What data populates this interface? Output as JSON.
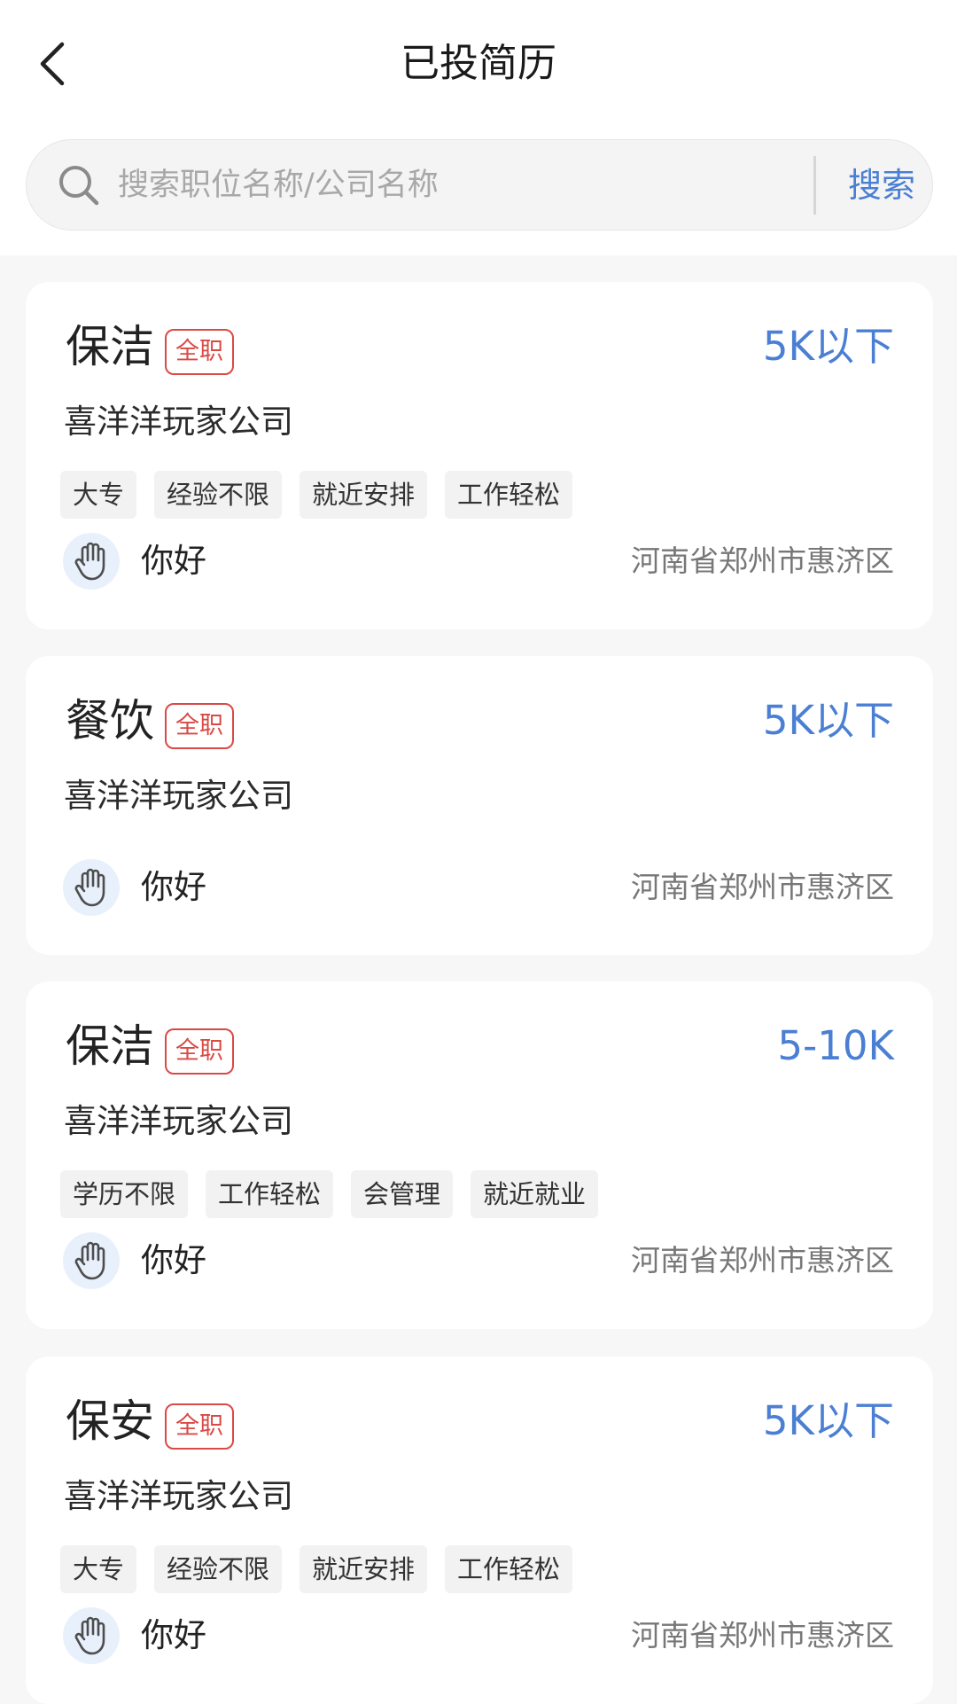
{
  "header": {
    "title": "已投简历"
  },
  "search": {
    "placeholder": "搜索职位名称/公司名称",
    "value": "",
    "button_label": "搜索"
  },
  "jobs": [
    {
      "title": "保洁",
      "type": "全职",
      "salary": "5K以下",
      "company": "喜洋洋玩家公司",
      "tags": [
        "大专",
        "经验不限",
        "就近安排",
        "工作轻松"
      ],
      "greeting": "你好",
      "location": "河南省郑州市惠济区"
    },
    {
      "title": "餐饮",
      "type": "全职",
      "salary": "5K以下",
      "company": "喜洋洋玩家公司",
      "tags": [],
      "greeting": "你好",
      "location": "河南省郑州市惠济区"
    },
    {
      "title": "保洁",
      "type": "全职",
      "salary": "5-10K",
      "company": "喜洋洋玩家公司",
      "tags": [
        "学历不限",
        "工作轻松",
        "会管理",
        "就近就业"
      ],
      "greeting": "你好",
      "location": "河南省郑州市惠济区"
    },
    {
      "title": "保安",
      "type": "全职",
      "salary": "5K以下",
      "company": "喜洋洋玩家公司",
      "tags": [
        "大专",
        "经验不限",
        "就近安排",
        "工作轻松"
      ],
      "greeting": "你好",
      "location": "河南省郑州市惠济区"
    }
  ],
  "colors": {
    "accent": "#4a7fd3",
    "badge": "#d94a45",
    "page_background": "#f7f7f7"
  },
  "icons": {
    "back": "chevron-left-icon",
    "search": "search-icon",
    "avatar": "hand-icon"
  }
}
